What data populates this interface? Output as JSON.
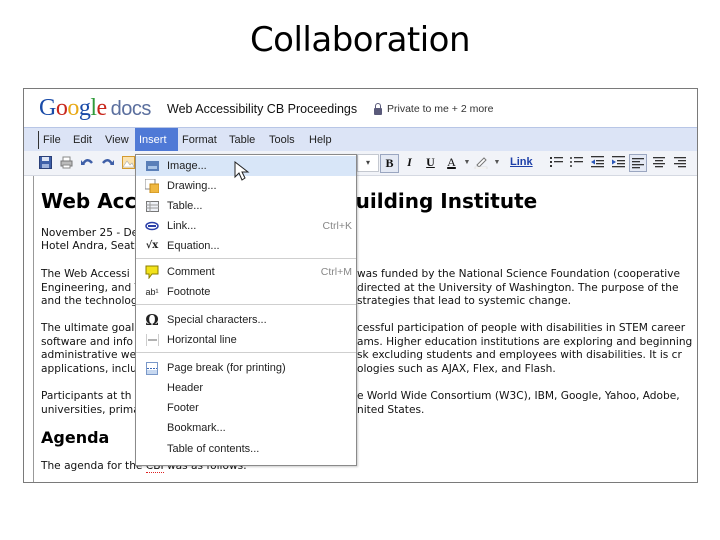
{
  "slide": {
    "title": "Collaboration"
  },
  "app": {
    "logo_google": [
      "G",
      "o",
      "o",
      "g",
      "l",
      "e"
    ],
    "logo_docs": "docs",
    "doc_title": "Web Accessibility CB Proceedings",
    "sharing": "Private to me + 2 more"
  },
  "menubar": {
    "items": [
      "File",
      "Edit",
      "View",
      "Insert",
      "Format",
      "Table",
      "Tools",
      "Help"
    ],
    "active": "Insert"
  },
  "toolbar": {
    "icons": [
      "save-icon",
      "print-icon",
      "undo-icon",
      "redo-icon",
      "insert-image-icon"
    ],
    "bold": "B",
    "italic": "I",
    "underline": "U",
    "text_color": "A",
    "link": "Link",
    "font_size_dropdown": "▾"
  },
  "insert_menu": {
    "items": [
      {
        "label": "Image...",
        "shortcut": "",
        "icon": "image-icon",
        "hover": true
      },
      {
        "label": "Drawing...",
        "shortcut": "",
        "icon": "drawing-icon"
      },
      {
        "label": "Table...",
        "shortcut": "",
        "icon": "table-icon"
      },
      {
        "label": "Link...",
        "shortcut": "Ctrl+K",
        "icon": "link-icon"
      },
      {
        "label": "Equation...",
        "shortcut": "",
        "icon": "equation-icon"
      },
      {
        "label": "Comment",
        "shortcut": "Ctrl+M",
        "icon": "comment-icon"
      },
      {
        "label": "Footnote",
        "shortcut": "",
        "icon": "footnote-icon"
      },
      {
        "label": "Special characters...",
        "shortcut": "",
        "icon": "omega-icon"
      },
      {
        "label": "Horizontal line",
        "shortcut": "",
        "icon": "horizontal-line-icon"
      },
      {
        "label": "Page break (for printing)",
        "shortcut": "",
        "icon": "page-break-icon"
      },
      {
        "label": "Header",
        "shortcut": ""
      },
      {
        "label": "Footer",
        "shortcut": ""
      },
      {
        "label": "Bookmark...",
        "shortcut": ""
      },
      {
        "label": "Table of contents...",
        "shortcut": ""
      }
    ]
  },
  "document": {
    "heading": "Web Accessibility Capacity Building Institute",
    "heading_visible_left": "Web Acc",
    "heading_visible_right": "Building Institute",
    "date_line_left": "November 25 - De",
    "venue_line_left": "Hotel Andra, Seat",
    "para1": {
      "left": [
        "The Web Accessi",
        "Engineering, and T",
        "and the technolog"
      ],
      "right": [
        "was funded by the National Science Foundation (cooperative",
        "directed at the University of Washington. The purpose of the",
        "strategies that lead to systemic change."
      ]
    },
    "para2": {
      "left": [
        "The ultimate goal",
        "software and info",
        "administrative we",
        "applications, inclu"
      ],
      "right": [
        "cessful participation of people with disabilities in STEM career",
        "ams. Higher education institutions are exploring and beginning",
        "sk excluding students and employees with disabilities. It is cr",
        "ologies such as AJAX, Flex, and Flash."
      ]
    },
    "para3": {
      "left": [
        "Participants at th",
        "universities, prima"
      ],
      "right": [
        "e World Wide Consortium (W3C), IBM, Google, Yahoo, Adobe,",
        "nited States."
      ]
    },
    "agenda_heading": "Agenda",
    "agenda_text_prefix": "The agenda for the ",
    "agenda_text_misspelled": "CBI",
    "agenda_text_suffix": " was as follows:"
  }
}
